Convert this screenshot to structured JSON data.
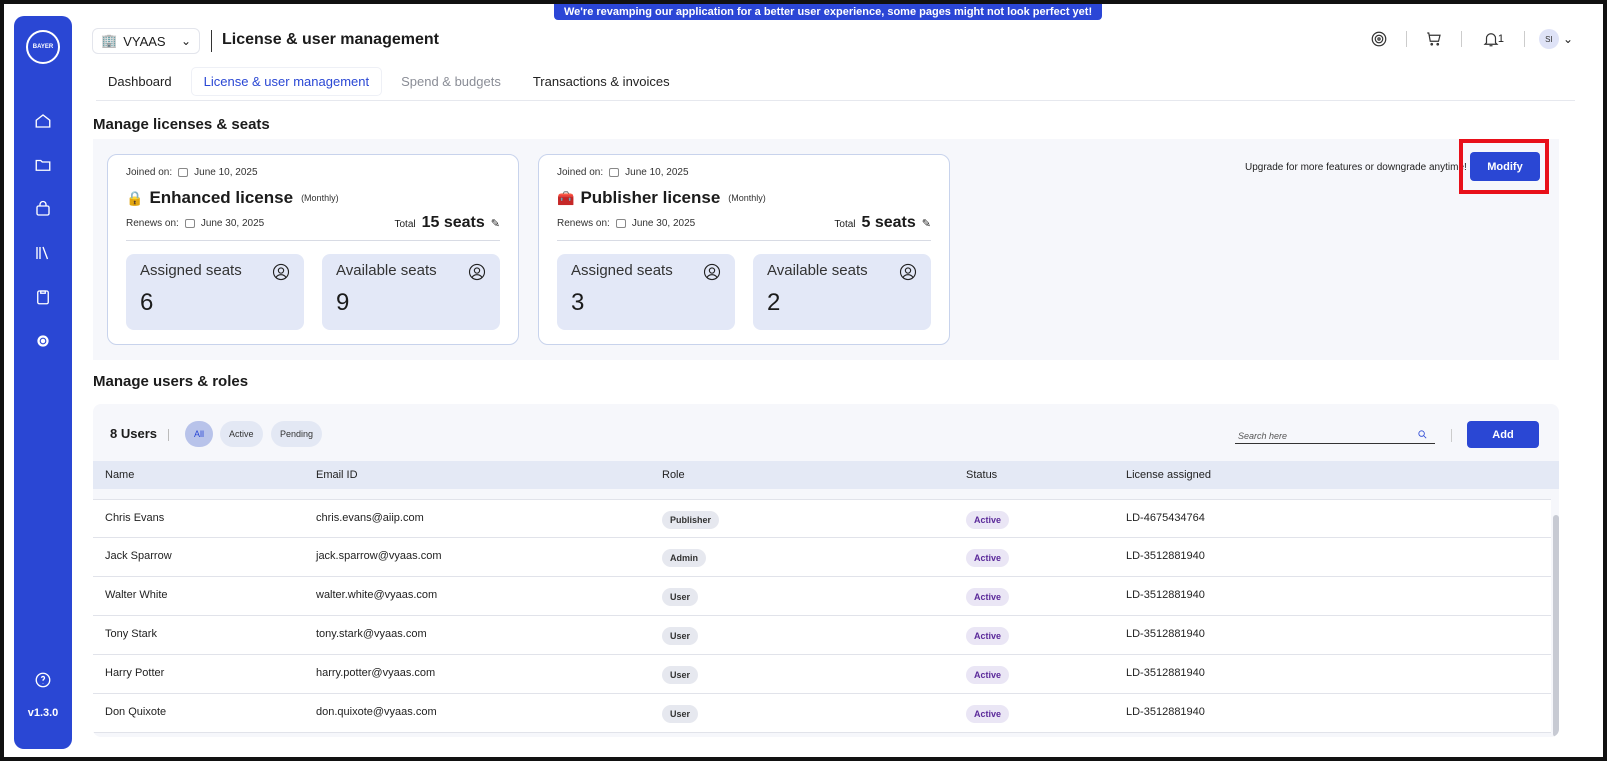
{
  "banner": "We're revamping our application for a better user experience, some pages might not look perfect yet!",
  "sidebar": {
    "logo_text": "BAYER",
    "items": [
      "home-icon",
      "folder-icon",
      "bag-icon",
      "library-icon",
      "clipboard-icon",
      "settings-icon"
    ],
    "help_icon": "help-icon",
    "version": "v1.3.0"
  },
  "header": {
    "org": "VYAAS",
    "title": "License & user management",
    "notification_count": "1",
    "avatar_initials": "SI"
  },
  "tabs": [
    "Dashboard",
    "License & user management",
    "Spend & budgets",
    "Transactions & invoices"
  ],
  "licenses_section": {
    "title": "Manage licenses & seats",
    "upgrade_text": "Upgrade for more features or downgrade anytime!",
    "modify_label": "Modify",
    "cards": [
      {
        "joined_label": "Joined on:",
        "joined_date": "June 10, 2025",
        "name": "Enhanced license",
        "period": "(Monthly)",
        "renews_label": "Renews on:",
        "renews_date": "June 30, 2025",
        "total_label": "Total",
        "total_seats": "15 seats",
        "assigned_label": "Assigned seats",
        "assigned": "6",
        "available_label": "Available seats",
        "available": "9"
      },
      {
        "joined_label": "Joined on:",
        "joined_date": "June 10, 2025",
        "name": "Publisher license",
        "period": "(Monthly)",
        "renews_label": "Renews on:",
        "renews_date": "June 30, 2025",
        "total_label": "Total",
        "total_seats": "5 seats",
        "assigned_label": "Assigned seats",
        "assigned": "3",
        "available_label": "Available seats",
        "available": "2"
      }
    ]
  },
  "users_section": {
    "title": "Manage users & roles",
    "count": "8 Users",
    "filters": [
      "All",
      "Active",
      "Pending"
    ],
    "search_placeholder": "Search here",
    "add_label": "Add",
    "columns": [
      "Name",
      "Email ID",
      "Role",
      "Status",
      "License assigned"
    ],
    "rows": [
      {
        "name": "Chris Evans",
        "email": "chris.evans@aiip.com",
        "role": "Publisher",
        "status": "Active",
        "license": "LD-4675434764"
      },
      {
        "name": "Jack Sparrow",
        "email": "jack.sparrow@vyaas.com",
        "role": "Admin",
        "status": "Active",
        "license": "LD-3512881940"
      },
      {
        "name": "Walter White",
        "email": "walter.white@vyaas.com",
        "role": "User",
        "status": "Active",
        "license": "LD-3512881940"
      },
      {
        "name": "Tony Stark",
        "email": "tony.stark@vyaas.com",
        "role": "User",
        "status": "Active",
        "license": "LD-3512881940"
      },
      {
        "name": "Harry Potter",
        "email": "harry.potter@vyaas.com",
        "role": "User",
        "status": "Active",
        "license": "LD-3512881940"
      },
      {
        "name": "Don Quixote",
        "email": "don.quixote@vyaas.com",
        "role": "User",
        "status": "Active",
        "license": "LD-3512881940"
      }
    ]
  }
}
